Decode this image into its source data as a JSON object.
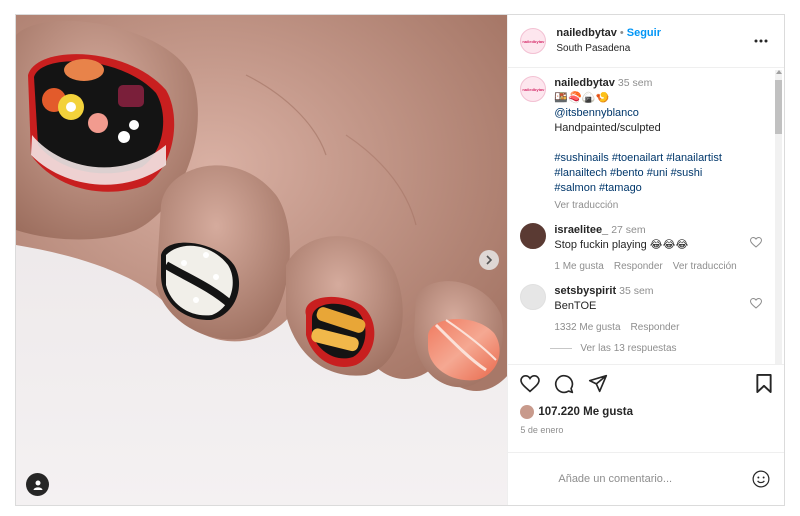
{
  "post": {
    "username": "nailedbytav",
    "avatar_text": "nailedbytav",
    "follow_label": "Seguir",
    "location": "South Pasadena",
    "caption_time": "35 sem",
    "caption_emoji": "🍱🍣🍙🍤",
    "caption_mention": "@itsbennyblanco",
    "caption_line": "Handpainted/sculpted",
    "hashtags": [
      "#sushinails #toenailart #lanailartist",
      "#lanailtech #bento #uni #sushi",
      "#salmon #tamago"
    ],
    "translate": "Ver traducción"
  },
  "comments": [
    {
      "username": "israelitee_",
      "time": "27 sem",
      "text": "Stop fuckin playing 😂😂😂",
      "likes": "1 Me gusta",
      "reply": "Responder",
      "translate": "Ver traducción"
    },
    {
      "username": "setsbyspirit",
      "time": "35 sem",
      "text": "BenTOE",
      "likes": "1332 Me gusta",
      "reply": "Responder",
      "replies": "Ver las 13 respuestas"
    }
  ],
  "footer": {
    "likes_count": "107.220 Me gusta",
    "date": "5 de enero",
    "comment_placeholder": "Añade un comentario..."
  },
  "colors": {
    "follow": "#0095f6",
    "border": "#dbdbdb",
    "muted": "#8e8e8e"
  }
}
